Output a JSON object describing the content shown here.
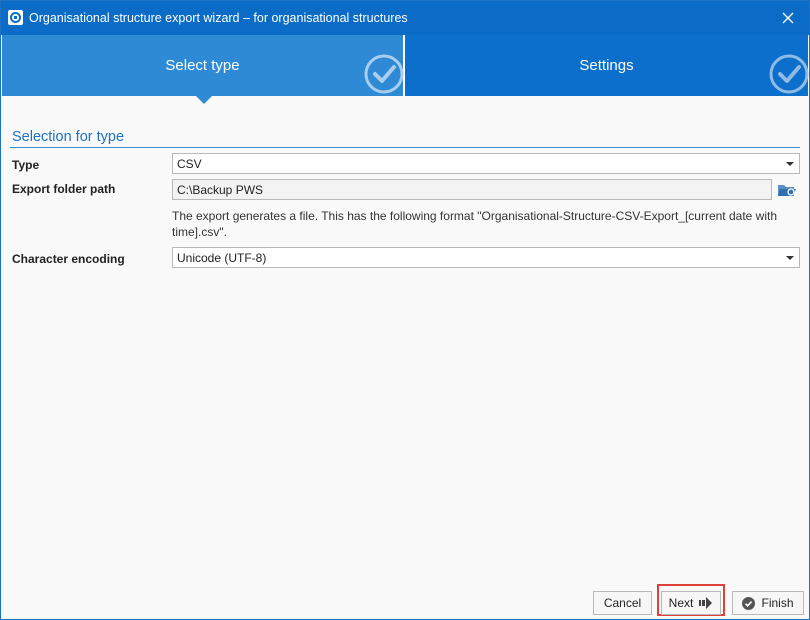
{
  "window": {
    "title": "Organisational structure export wizard – for organisational structures",
    "app_icon": "app-logo-icon",
    "close_icon": "close-icon"
  },
  "steps": [
    {
      "label": "Select type",
      "state": "active",
      "icon": "check-circle-icon"
    },
    {
      "label": "Settings",
      "state": "pending",
      "icon": "check-circle-icon"
    }
  ],
  "section": {
    "title": "Selection for type"
  },
  "form": {
    "type_label": "Type",
    "type_value": "CSV",
    "export_path_label": "Export folder path",
    "export_path_value": "C:\\Backup PWS",
    "browse_icon": "folder-browse-icon",
    "hint": "The export generates a file. This has the following format \"Organisational-Structure-CSV-Export_[current date with time].csv\".",
    "encoding_label": "Character encoding",
    "encoding_value": "Unicode (UTF-8)"
  },
  "buttons": {
    "cancel": "Cancel",
    "next": "Next",
    "next_icon": "arrow-right-icon",
    "finish": "Finish",
    "finish_icon": "check-circle-icon"
  },
  "colors": {
    "titlebar": "#0a6cc7",
    "active_step": "#2f8ad6",
    "inactive_step": "#0c6fcb",
    "accent": "#1e72c4",
    "highlight": "#e0403a"
  }
}
